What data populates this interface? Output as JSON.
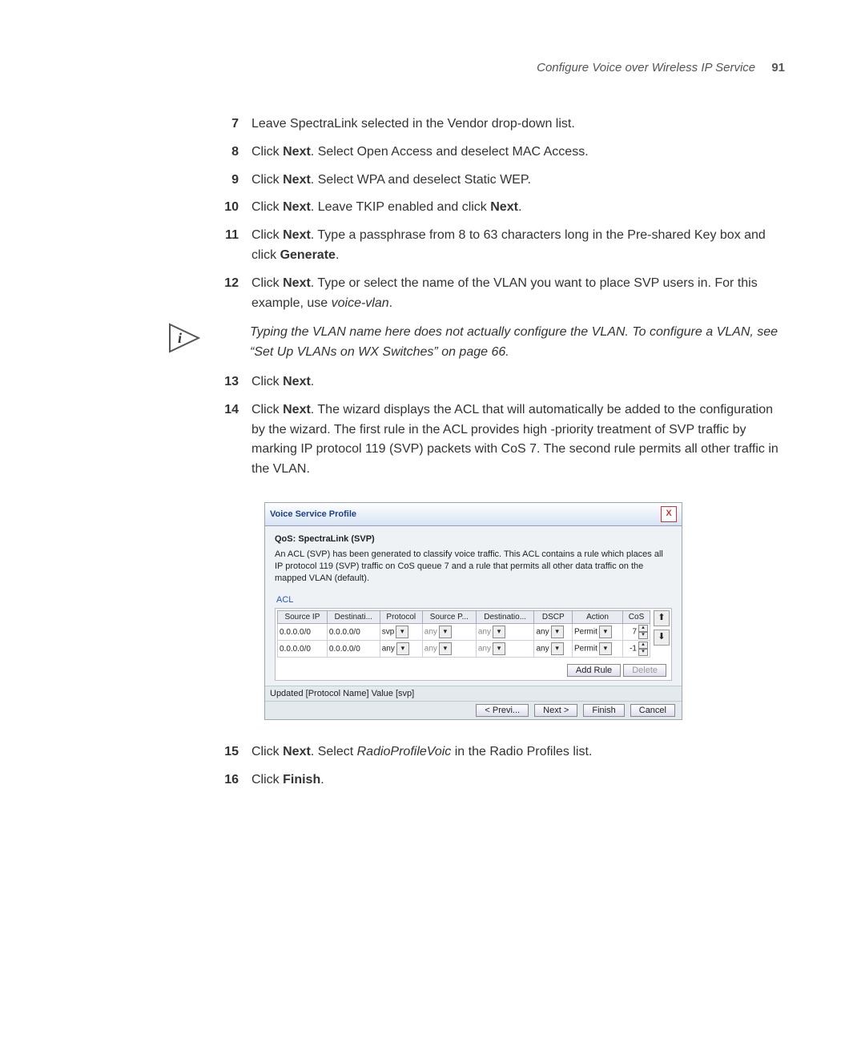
{
  "header": {
    "title": "Configure Voice over Wireless IP Service",
    "page": "91"
  },
  "steps": {
    "7": {
      "num": "7",
      "text": "Leave SpectraLink selected in the Vendor drop-down list."
    },
    "8": {
      "num": "8",
      "pre": "Click ",
      "b": "Next",
      "post": ". Select Open Access and deselect MAC Access."
    },
    "9": {
      "num": "9",
      "pre": "Click ",
      "b": "Next",
      "post": ". Select WPA and deselect Static WEP."
    },
    "10": {
      "num": "10",
      "pre": "Click ",
      "b1": "Next",
      "mid1": ". Leave TKIP enabled and click ",
      "b2": "Next",
      "post": "."
    },
    "11": {
      "num": "11",
      "pre": "Click ",
      "b1": "Next",
      "mid1": ". Type a passphrase from 8 to 63 characters long in the Pre-shared Key box and click ",
      "b2": "Generate",
      "post": "."
    },
    "12": {
      "num": "12",
      "pre": "Click ",
      "b": "Next",
      "mid": ". Type or select the name of the VLAN you want to place SVP users in. For this example, use ",
      "ital": "voice-vlan",
      "post": "."
    },
    "info": {
      "text": "Typing the VLAN name here does not actually configure the VLAN. To configure a VLAN, see “Set Up VLANs on WX Switches” on page 66."
    },
    "13": {
      "num": "13",
      "pre": "Click ",
      "b": "Next",
      "post": "."
    },
    "14": {
      "num": "14",
      "pre": "Click ",
      "b": "Next",
      "post": ". The wizard displays the ACL that will automatically be added to the configuration by the wizard. The first rule in the ACL provides high -priority treatment of SVP traffic by marking IP protocol 119 (SVP) packets with CoS 7. The second rule permits all other traffic in the VLAN."
    },
    "15": {
      "num": "15",
      "pre": "Click ",
      "b": "Next",
      "mid": ". Select ",
      "ital": "RadioProfileVoic",
      "post": " in the Radio Profiles list."
    },
    "16": {
      "num": "16",
      "pre": "Click ",
      "b": "Finish",
      "post": "."
    }
  },
  "dialog": {
    "title": "Voice Service Profile",
    "close": "X",
    "qos_heading": "QoS: SpectraLink (SVP)",
    "acl_desc": "An ACL (SVP) has been generated to classify voice traffic. This ACL contains a rule which places all IP protocol 119 (SVP) traffic on CoS queue 7 and a rule that permits all other data traffic on the mapped VLAN (default).",
    "acl_label": "ACL",
    "columns": {
      "c1": "Source IP",
      "c2": "Destinati...",
      "c3": "Protocol",
      "c4": "Source P...",
      "c5": "Destinatio...",
      "c6": "DSCP",
      "c7": "Action",
      "c8": "CoS"
    },
    "rows": [
      {
        "src": "0.0.0.0/0",
        "dst": "0.0.0.0/0",
        "proto": "svp",
        "sport": "any",
        "dport": "any",
        "dscp": "any",
        "action": "Permit",
        "cos": "7"
      },
      {
        "src": "0.0.0.0/0",
        "dst": "0.0.0.0/0",
        "proto": "any",
        "sport": "any",
        "dport": "any",
        "dscp": "any",
        "action": "Permit",
        "cos": "-1"
      }
    ],
    "add_rule": "Add Rule",
    "delete": "Delete",
    "status": "Updated [Protocol Name] Value [svp]",
    "prev": "< Previ...",
    "next": "Next >",
    "finish": "Finish",
    "cancel": "Cancel"
  }
}
